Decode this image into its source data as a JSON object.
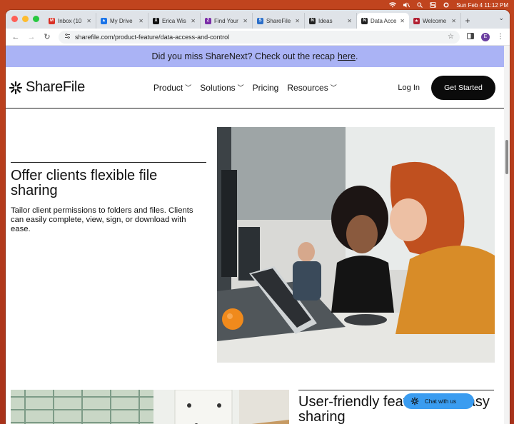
{
  "menubar": {
    "datetime": "Sun Feb 4  11:12 PM"
  },
  "tabs": [
    {
      "label": "Inbox (10",
      "icon": "gmail-icon",
      "color": "#d93025",
      "glyph": "M"
    },
    {
      "label": "My Drive",
      "icon": "drive-icon",
      "color": "#1a73e8",
      "glyph": "▲"
    },
    {
      "label": "Erica Wis",
      "icon": "x-icon",
      "color": "#111111",
      "glyph": "X"
    },
    {
      "label": "Find Your",
      "icon": "z-icon",
      "color": "#7b2ea8",
      "glyph": "Z"
    },
    {
      "label": "ShareFile",
      "icon": "sharefile-icon",
      "color": "#2a6ec9",
      "glyph": "S"
    },
    {
      "label": "Ideas",
      "icon": "notion-icon",
      "color": "#222222",
      "glyph": "N"
    },
    {
      "label": "Data Acce",
      "icon": "notion-icon",
      "color": "#222222",
      "glyph": "N",
      "active": true
    },
    {
      "label": "Welcome",
      "icon": "flag-icon",
      "color": "#b22234",
      "glyph": "★"
    }
  ],
  "address": {
    "url": "sharefile.com/product-feature/data-access-and-control"
  },
  "profile": {
    "initial": "E"
  },
  "banner": {
    "text": "Did you miss ShareNext? Check out the recap",
    "link": "here",
    "suffix": "."
  },
  "nav": {
    "logo": "ShareFile",
    "items": [
      "Product",
      "Solutions",
      "Pricing",
      "Resources"
    ],
    "login": "Log In",
    "cta": "Get Started"
  },
  "feature": {
    "title": "Offer clients flexible file sharing",
    "description": "Tailor client permissions to folders and files. Clients can easily complete, view, sign, or download with ease."
  },
  "feature2": {
    "title": "User-friendly features for easy sharing"
  },
  "chat": {
    "label": "Chat with us"
  },
  "colors": {
    "banner": "#aab3f5",
    "cta": "#0b0b0b",
    "chat": "#3a9cf0",
    "profile": "#6b3fa0"
  }
}
